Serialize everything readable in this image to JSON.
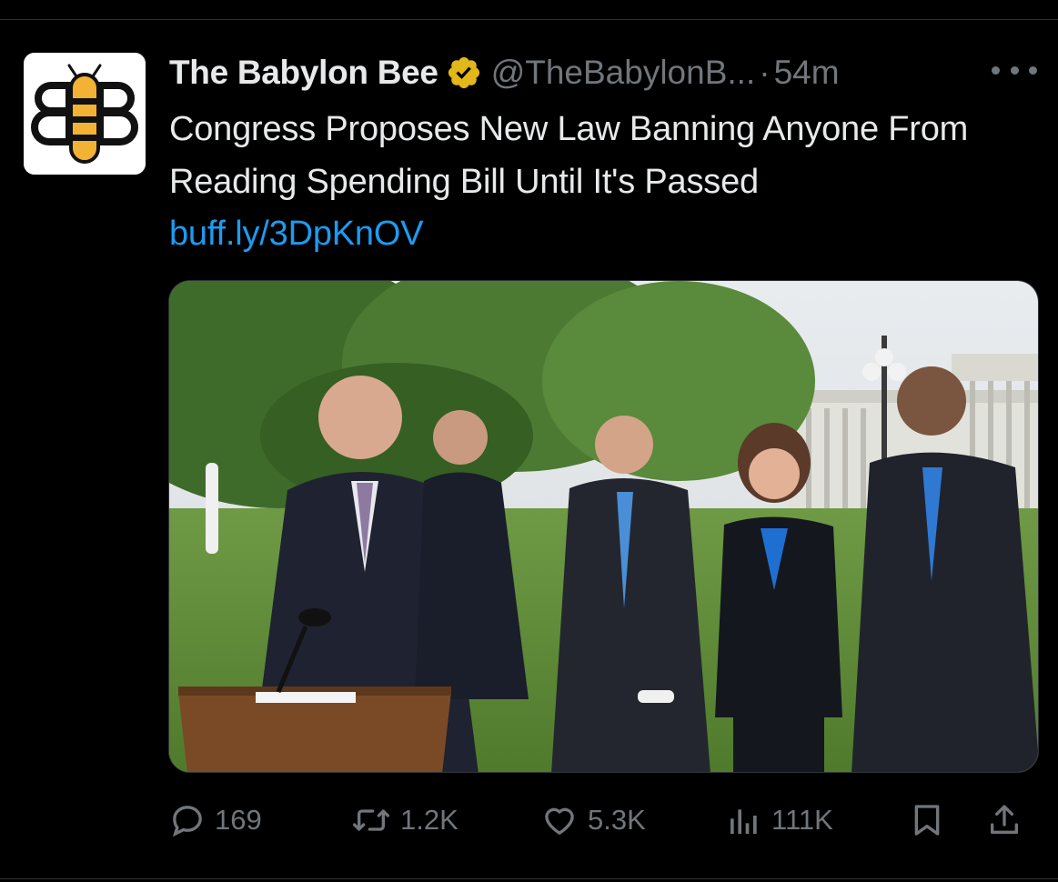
{
  "tweet": {
    "display_name": "The Babylon Bee",
    "handle": "@TheBabylonB...",
    "separator": "·",
    "time": "54m",
    "text": "Congress Proposes New Law Banning Anyone From Reading Spending Bill Until It's Passed",
    "link": "buff.ly/3DpKnOV"
  },
  "media": {
    "description_icon": "press-conference-photo"
  },
  "actions": {
    "replies": "169",
    "reposts": "1.2K",
    "likes": "5.3K",
    "views": "111K"
  },
  "colors": {
    "background": "#000000",
    "text_primary": "#e7e9ea",
    "text_secondary": "#71767b",
    "link": "#1d9bf0",
    "verified": "#e2b719",
    "bee_yellow": "#f2b233"
  }
}
